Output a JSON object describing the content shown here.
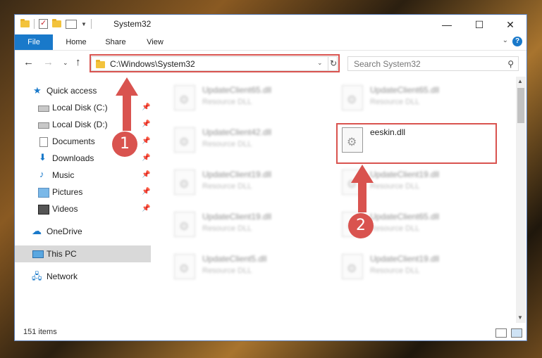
{
  "window": {
    "title": "System32"
  },
  "ribbon": {
    "tabs": [
      "File",
      "Home",
      "Share",
      "View"
    ],
    "help": "?"
  },
  "address": {
    "path": "C:\\Windows\\System32",
    "refresh": "↻"
  },
  "search": {
    "placeholder": "Search System32"
  },
  "sidebar": {
    "items": [
      {
        "label": "Quick access",
        "icon": "star-icon"
      },
      {
        "label": "Local Disk (C:)",
        "icon": "drive-icon",
        "pinned": true
      },
      {
        "label": "Local Disk (D:)",
        "icon": "drive-icon",
        "pinned": true
      },
      {
        "label": "Documents",
        "icon": "documents-icon",
        "pinned": true
      },
      {
        "label": "Downloads",
        "icon": "downloads-icon",
        "pinned": true
      },
      {
        "label": "Music",
        "icon": "music-icon",
        "pinned": true
      },
      {
        "label": "Pictures",
        "icon": "pictures-icon",
        "pinned": true
      },
      {
        "label": "Videos",
        "icon": "videos-icon",
        "pinned": true
      },
      {
        "label": "OneDrive",
        "icon": "onedrive-icon"
      },
      {
        "label": "This PC",
        "icon": "this-pc-icon",
        "selected": true
      },
      {
        "label": "Network",
        "icon": "network-icon"
      }
    ]
  },
  "files": [
    {
      "name": "UpdateClient65.dll",
      "type": "Resource DLL"
    },
    {
      "name": "UpdateClient65.dll",
      "type": "Resource DLL"
    },
    {
      "name": "UpdateClient42.dll",
      "type": "Resource DLL"
    },
    {
      "name": "eeskin.dll",
      "type": ""
    },
    {
      "name": "UpdateClient19.dll",
      "type": "Resource DLL"
    },
    {
      "name": "UpdateClient19.dll",
      "type": "Resource DLL"
    },
    {
      "name": "UpdateClient19.dll",
      "type": "Resource DLL"
    },
    {
      "name": "UpdateClient65.dll",
      "type": "Resource DLL"
    },
    {
      "name": "UpdateClient5.dll",
      "type": "Resource DLL"
    },
    {
      "name": "UpdateClient19.dll",
      "type": "Resource DLL"
    }
  ],
  "status": {
    "items": "151 items"
  },
  "markers": [
    "1",
    "2"
  ],
  "colors": {
    "accent": "#1979ca",
    "highlight": "#d9534f"
  }
}
